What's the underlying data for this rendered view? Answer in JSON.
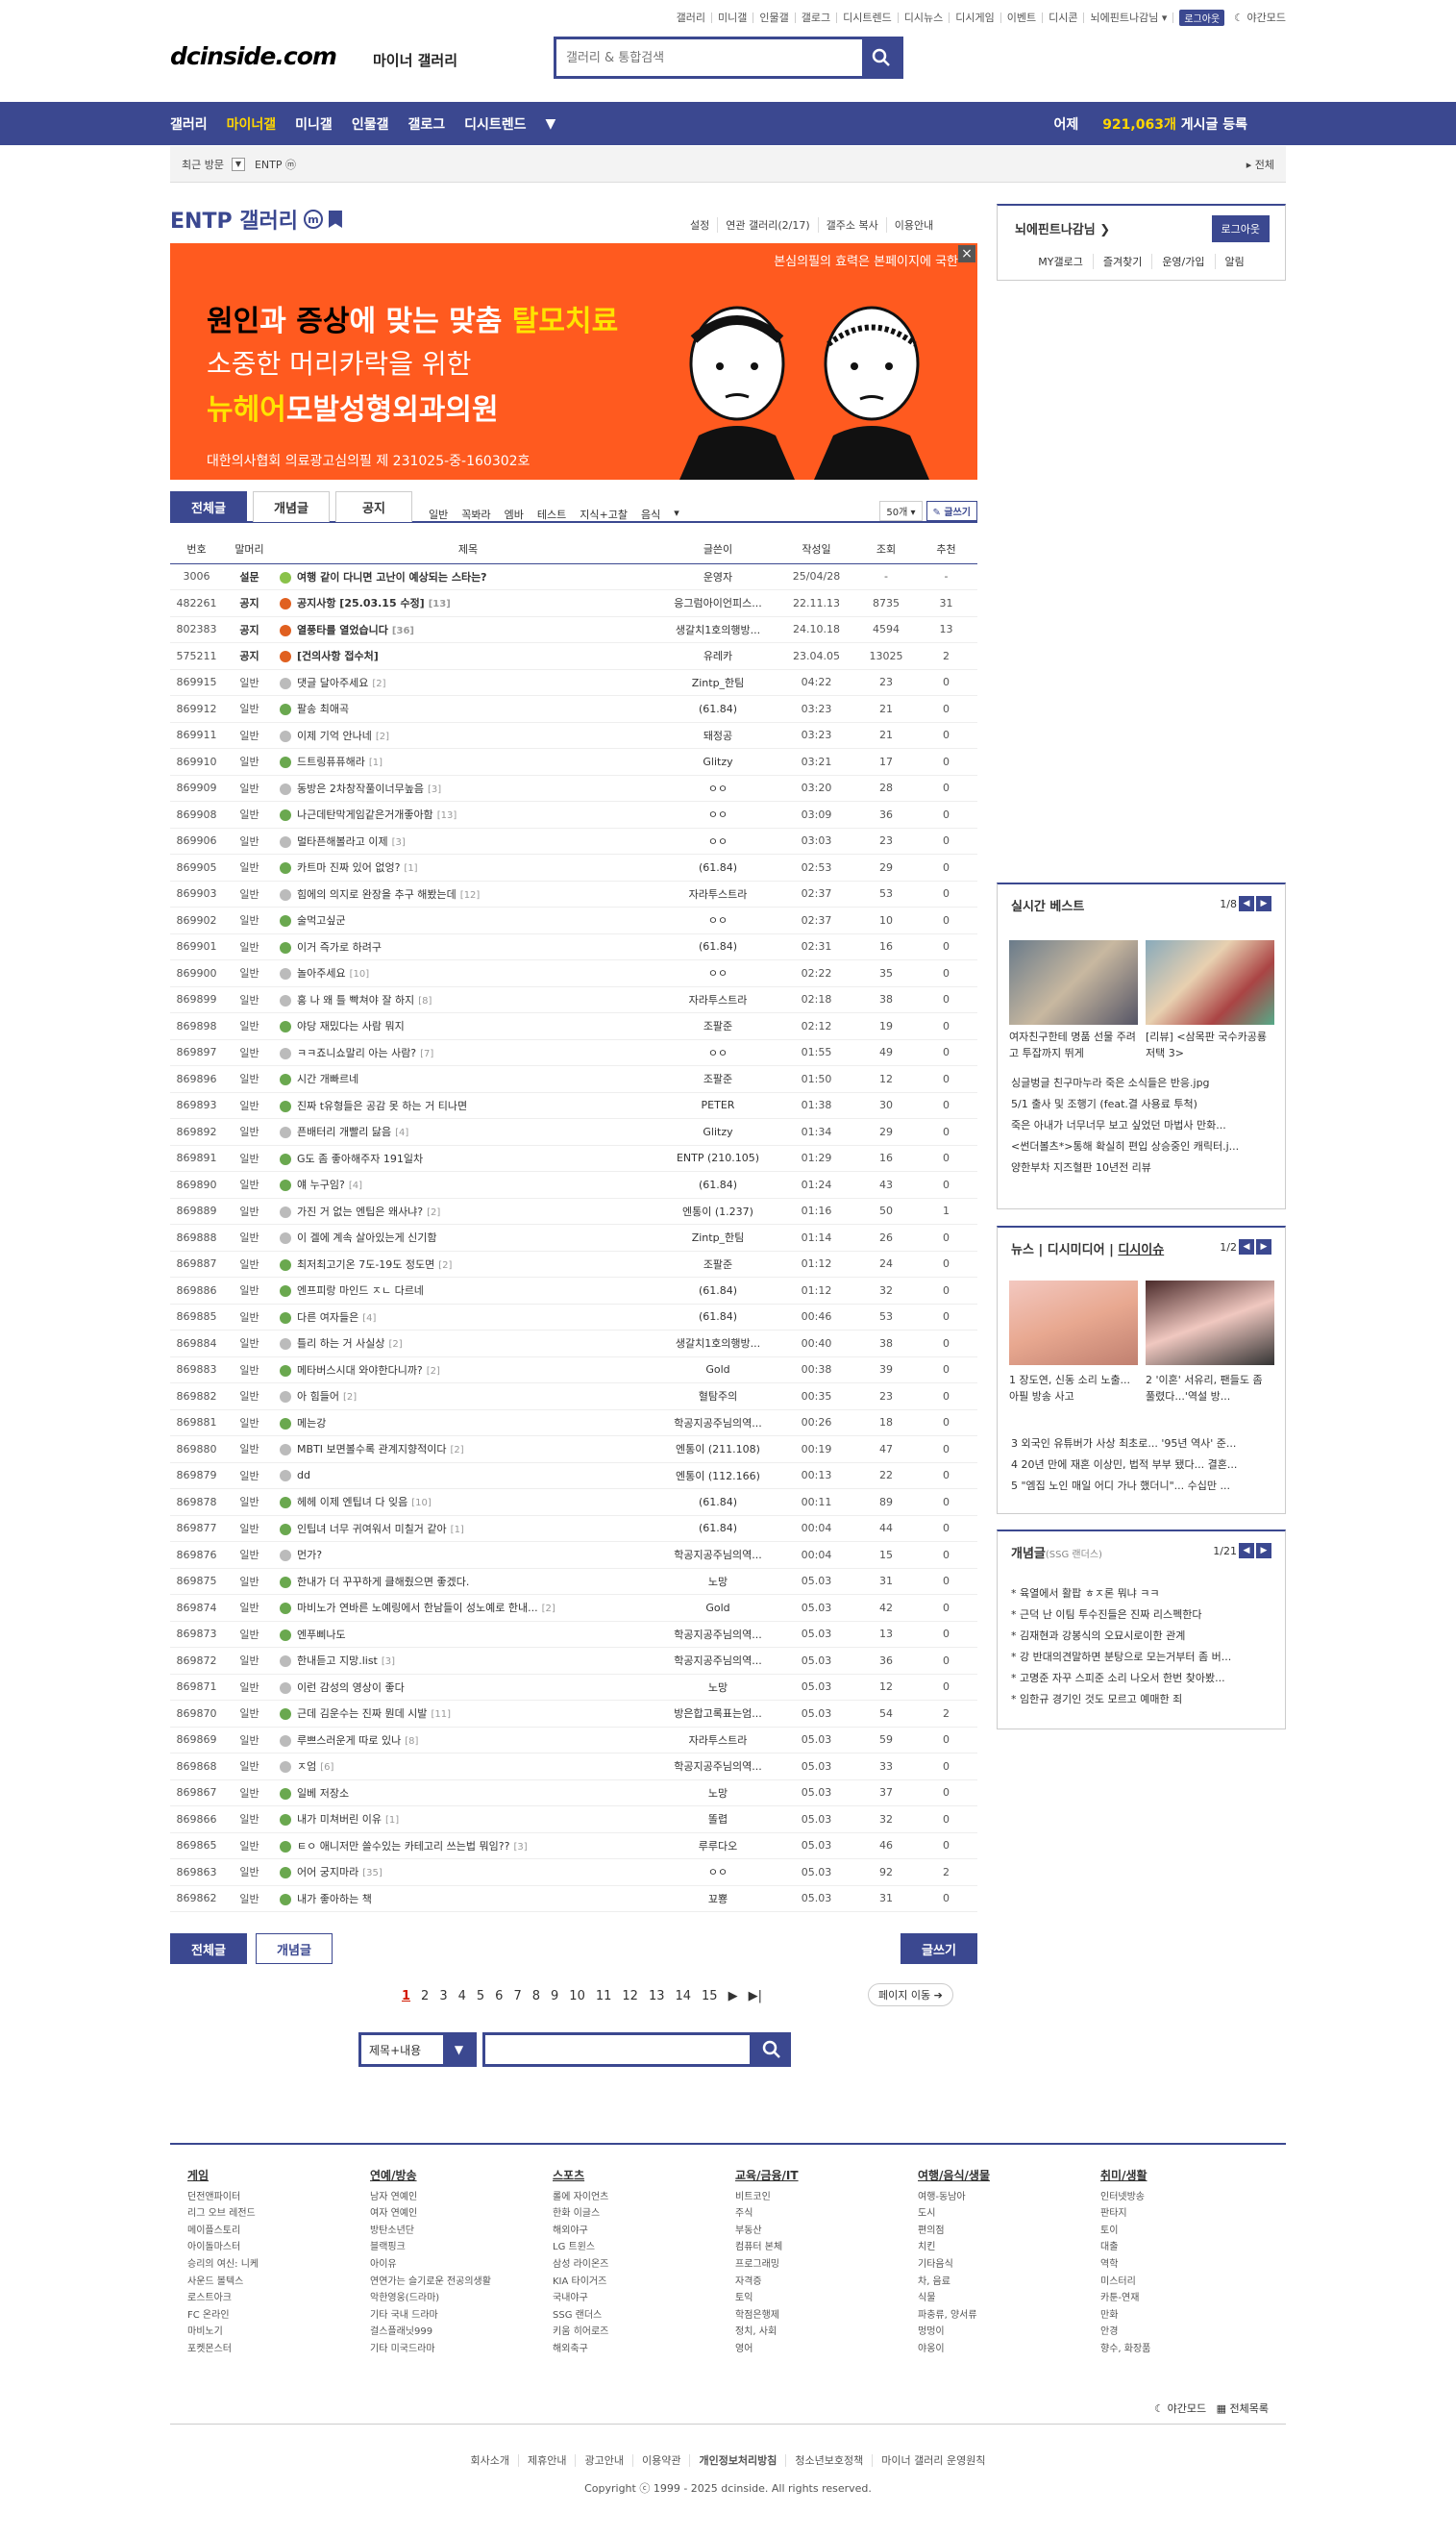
{
  "util": [
    "갤러리",
    "미니갤",
    "인물갤",
    "갤로그",
    "디시트렌드",
    "디시뉴스",
    "디시게임",
    "이벤트",
    "디시콘"
  ],
  "util_user": "뇌에핀트나감님",
  "util_logout": "로그아웃",
  "util_night": "야간모드",
  "logo": "dcinside.com",
  "logo_sub": "마이너 갤러리",
  "search_placeholder": "갤러리 & 통합검색",
  "nav": [
    "갤러리",
    "마이너갤",
    "미니갤",
    "인물갤",
    "갤로그",
    "디시트렌드"
  ],
  "visitors": {
    "pre": "어제",
    "count": "921,063개",
    "post": "게시글 등록"
  },
  "recent": {
    "label": "최근 방문",
    "item": "ENTP ⓜ",
    "all": "전체"
  },
  "gallery": {
    "title": "ENTP 갤러리",
    "badge": "m"
  },
  "gtools": [
    "설정",
    "연관 갤러리(2/17)",
    "갤주소 복사",
    "이용안내"
  ],
  "banner": {
    "top": "본심의필의 효력은 본페이지에 국한",
    "l1a": "원인",
    "l1b": "과 ",
    "l1c": "증상",
    "l1d": "에 맞는 맞춤 ",
    "l1e": "탈모치료",
    "l2": "소중한 머리카락을 위한",
    "l3a": "뉴헤어",
    "l3b": "모발성형외과의원",
    "l4": "대한의사협회 의료광고심의필 제 231025-중-160302호"
  },
  "login": {
    "nick": "뇌에핀트나감님",
    "logout": "로그아웃",
    "links": [
      "MY갤로그",
      "즐겨찾기",
      "운영/가입",
      "알림"
    ]
  },
  "tabs": [
    "전체글",
    "개념글",
    "공지"
  ],
  "filters": [
    "일반",
    "꼭봐라",
    "엠바",
    "테스트",
    "지식+고찰",
    "음식"
  ],
  "listopt": {
    "num": "50개",
    "write": "글쓰기"
  },
  "headers": [
    "번호",
    "말머리",
    "제목",
    "글쓴이",
    "작성일",
    "조회",
    "추천"
  ],
  "rows": [
    {
      "no": "3006",
      "h": "설문",
      "t": "여행 같이 다니면 고난이 예상되는 스타는?",
      "c": "",
      "w": "운영자",
      "d": "25/04/28",
      "v": "-",
      "r": "-",
      "k": "s",
      "b": 1
    },
    {
      "no": "482261",
      "h": "공지",
      "t": "공지사항 [25.03.15 수정]",
      "c": "[13]",
      "w": "응그럼아이언피스...",
      "d": "22.11.13",
      "v": "8735",
      "r": "31",
      "k": "n",
      "b": 1
    },
    {
      "no": "802383",
      "h": "공지",
      "t": "열풍타를 열었습니다",
      "c": "[36]",
      "w": "생갈치1호의행방...",
      "d": "24.10.18",
      "v": "4594",
      "r": "13",
      "k": "n",
      "b": 1
    },
    {
      "no": "575211",
      "h": "공지",
      "t": "[건의사항 접수처]",
      "c": "",
      "w": "유레카",
      "d": "23.04.05",
      "v": "13025",
      "r": "2",
      "k": "n",
      "b": 1
    },
    {
      "no": "869915",
      "h": "일반",
      "t": "댓글 달아주세요",
      "c": "[2]",
      "w": "Zintp_한팀",
      "d": "04:22",
      "v": "23",
      "r": "0",
      "k": "c"
    },
    {
      "no": "869912",
      "h": "일반",
      "t": "팔송 최애곡",
      "c": "",
      "w": "(61.84)",
      "d": "03:23",
      "v": "21",
      "r": "0",
      "k": "g"
    },
    {
      "no": "869911",
      "h": "일반",
      "t": "이제 기억 안나네",
      "c": "[2]",
      "w": "돼정공",
      "d": "03:23",
      "v": "21",
      "r": "0",
      "k": "c"
    },
    {
      "no": "869910",
      "h": "일반",
      "t": "드트링퓨퓨해라",
      "c": "[1]",
      "w": "Glitzy",
      "d": "03:21",
      "v": "17",
      "r": "0",
      "k": "g"
    },
    {
      "no": "869909",
      "h": "일반",
      "t": "동방은 2차창작풀이너무높음",
      "c": "[3]",
      "w": "ㅇㅇ",
      "d": "03:20",
      "v": "28",
      "r": "0",
      "k": "c"
    },
    {
      "no": "869908",
      "h": "일반",
      "t": "나근데탄막게임같은거개좋아함",
      "c": "[13]",
      "w": "ㅇㅇ",
      "d": "03:09",
      "v": "36",
      "r": "0",
      "k": "g"
    },
    {
      "no": "869906",
      "h": "일반",
      "t": "멀타픈해볼라고 이제",
      "c": "[3]",
      "w": "ㅇㅇ",
      "d": "03:03",
      "v": "23",
      "r": "0",
      "k": "c"
    },
    {
      "no": "869905",
      "h": "일반",
      "t": "카트마 진짜 있어 없엉?",
      "c": "[1]",
      "w": "(61.84)",
      "d": "02:53",
      "v": "29",
      "r": "0",
      "k": "g"
    },
    {
      "no": "869903",
      "h": "일반",
      "t": "힘에의 의지로 완장을 추구 해봤는데",
      "c": "[12]",
      "w": "자라투스트라",
      "d": "02:37",
      "v": "53",
      "r": "0",
      "k": "c"
    },
    {
      "no": "869902",
      "h": "일반",
      "t": "술먹고싶군",
      "c": "",
      "w": "ㅇㅇ",
      "d": "02:37",
      "v": "10",
      "r": "0",
      "k": "g"
    },
    {
      "no": "869901",
      "h": "일반",
      "t": "이거 즉가로 하려구",
      "c": "",
      "w": "(61.84)",
      "d": "02:31",
      "v": "16",
      "r": "0",
      "k": "g"
    },
    {
      "no": "869900",
      "h": "일반",
      "t": "놀아주세요",
      "c": "[10]",
      "w": "ㅇㅇ",
      "d": "02:22",
      "v": "35",
      "r": "0",
      "k": "c"
    },
    {
      "no": "869899",
      "h": "일반",
      "t": "홍 나 왜 틀 빡쳐야 잘 하지",
      "c": "[8]",
      "w": "자라투스트라",
      "d": "02:18",
      "v": "38",
      "r": "0",
      "k": "c"
    },
    {
      "no": "869898",
      "h": "일반",
      "t": "야당 재밌다는 사람 뭐지",
      "c": "",
      "w": "조팔준",
      "d": "02:12",
      "v": "19",
      "r": "0",
      "k": "g"
    },
    {
      "no": "869897",
      "h": "일반",
      "t": "ㅋㅋ죠니쇼말리 아는 사람?",
      "c": "[7]",
      "w": "ㅇㅇ",
      "d": "01:55",
      "v": "49",
      "r": "0",
      "k": "c"
    },
    {
      "no": "869896",
      "h": "일반",
      "t": "시간 개빠르네",
      "c": "",
      "w": "조팔준",
      "d": "01:50",
      "v": "12",
      "r": "0",
      "k": "g"
    },
    {
      "no": "869893",
      "h": "일반",
      "t": "진짜 t유형들은 공감 못 하는 거 티나면",
      "c": "",
      "w": "PETER",
      "d": "01:38",
      "v": "30",
      "r": "0",
      "k": "g"
    },
    {
      "no": "869892",
      "h": "일반",
      "t": "픈배터리 개빨리 닳음",
      "c": "[4]",
      "w": "Glitzy",
      "d": "01:34",
      "v": "29",
      "r": "0",
      "k": "c"
    },
    {
      "no": "869891",
      "h": "일반",
      "t": "G도 좀 좋아해주자 191일차",
      "c": "",
      "w": "ENTP (210.105)",
      "d": "01:29",
      "v": "16",
      "r": "0",
      "k": "g"
    },
    {
      "no": "869890",
      "h": "일반",
      "t": "얘 누구임?",
      "c": "[4]",
      "w": "(61.84)",
      "d": "01:24",
      "v": "43",
      "r": "0",
      "k": "g"
    },
    {
      "no": "869889",
      "h": "일반",
      "t": "가진 거 없는 엔팁은 왜사냐?",
      "c": "[2]",
      "w": "엔통이 (1.237)",
      "d": "01:16",
      "v": "50",
      "r": "1",
      "k": "c"
    },
    {
      "no": "869888",
      "h": "일반",
      "t": "이 겔에 계속 살아있는게 신기함",
      "c": "",
      "w": "Zintp_한팀",
      "d": "01:14",
      "v": "26",
      "r": "0",
      "k": "c"
    },
    {
      "no": "869887",
      "h": "일반",
      "t": "최저최고기온 7도-19도 정도면",
      "c": "[2]",
      "w": "조팔준",
      "d": "01:12",
      "v": "24",
      "r": "0",
      "k": "g"
    },
    {
      "no": "869886",
      "h": "일반",
      "t": "엔프피랑 마인드 ㅈㄴ 다르네",
      "c": "",
      "w": "(61.84)",
      "d": "01:12",
      "v": "32",
      "r": "0",
      "k": "g"
    },
    {
      "no": "869885",
      "h": "일반",
      "t": "다른 여자들은",
      "c": "[4]",
      "w": "(61.84)",
      "d": "00:46",
      "v": "53",
      "r": "0",
      "k": "g"
    },
    {
      "no": "869884",
      "h": "일반",
      "t": "틀리 하는 거 사실상",
      "c": "[2]",
      "w": "생갈치1호의행방...",
      "d": "00:40",
      "v": "38",
      "r": "0",
      "k": "c"
    },
    {
      "no": "869883",
      "h": "일반",
      "t": "메타버스시대 와야한다니까?",
      "c": "[2]",
      "w": "Gold",
      "d": "00:38",
      "v": "39",
      "r": "0",
      "k": "g"
    },
    {
      "no": "869882",
      "h": "일반",
      "t": "아 힘들어",
      "c": "[2]",
      "w": "혈탐주의",
      "d": "00:35",
      "v": "23",
      "r": "0",
      "k": "c"
    },
    {
      "no": "869881",
      "h": "일반",
      "t": "메는강",
      "c": "",
      "w": "학공지공주님의역...",
      "d": "00:26",
      "v": "18",
      "r": "0",
      "k": "g"
    },
    {
      "no": "869880",
      "h": "일반",
      "t": "MBTI 보면볼수록 관계지향적이다",
      "c": "[2]",
      "w": "엔통이 (211.108)",
      "d": "00:19",
      "v": "47",
      "r": "0",
      "k": "c"
    },
    {
      "no": "869879",
      "h": "일반",
      "t": "dd",
      "c": "",
      "w": "엔통이 (112.166)",
      "d": "00:13",
      "v": "22",
      "r": "0",
      "k": "c"
    },
    {
      "no": "869878",
      "h": "일반",
      "t": "헤헤 이제 엔팁녀 다 잊음",
      "c": "[10]",
      "w": "(61.84)",
      "d": "00:11",
      "v": "89",
      "r": "0",
      "k": "g"
    },
    {
      "no": "869877",
      "h": "일반",
      "t": "인팁녀 너무 귀여워서 미칠거 같아",
      "c": "[1]",
      "w": "(61.84)",
      "d": "00:04",
      "v": "44",
      "r": "0",
      "k": "g"
    },
    {
      "no": "869876",
      "h": "일반",
      "t": "먼가?",
      "c": "",
      "w": "학공지공주님의역...",
      "d": "00:04",
      "v": "15",
      "r": "0",
      "k": "c"
    },
    {
      "no": "869875",
      "h": "일반",
      "t": "한내가 더 꾸꾸하게 클해줬으면 좋겠다.",
      "c": "",
      "w": "노망",
      "d": "05.03",
      "v": "31",
      "r": "0",
      "k": "g"
    },
    {
      "no": "869874",
      "h": "일반",
      "t": "마비노가 연바른 노예링에서 한남들이 성노예로 한내...",
      "c": "[2]",
      "w": "Gold",
      "d": "05.03",
      "v": "42",
      "r": "0",
      "k": "g"
    },
    {
      "no": "869873",
      "h": "일반",
      "t": "엔푸삐나도",
      "c": "",
      "w": "학공지공주님의역...",
      "d": "05.03",
      "v": "13",
      "r": "0",
      "k": "g"
    },
    {
      "no": "869872",
      "h": "일반",
      "t": "한내듣고 지망.list",
      "c": "[3]",
      "w": "학공지공주님의역...",
      "d": "05.03",
      "v": "36",
      "r": "0",
      "k": "c"
    },
    {
      "no": "869871",
      "h": "일반",
      "t": "이런 감성의 영상이 좋다",
      "c": "",
      "w": "노망",
      "d": "05.03",
      "v": "12",
      "r": "0",
      "k": "c"
    },
    {
      "no": "869870",
      "h": "일반",
      "t": "근데 김운수는 진짜 뭔데 시발",
      "c": "[11]",
      "w": "방은합고록표는엄...",
      "d": "05.03",
      "v": "54",
      "r": "2",
      "k": "g"
    },
    {
      "no": "869869",
      "h": "일반",
      "t": "루쁘스러운게 따로 있나",
      "c": "[8]",
      "w": "자라투스트라",
      "d": "05.03",
      "v": "59",
      "r": "0",
      "k": "c"
    },
    {
      "no": "869868",
      "h": "일반",
      "t": "ㅈ엄",
      "c": "[6]",
      "w": "학공지공주님의역...",
      "d": "05.03",
      "v": "33",
      "r": "0",
      "k": "c"
    },
    {
      "no": "869867",
      "h": "일반",
      "t": "일베 저장소",
      "c": "",
      "w": "노망",
      "d": "05.03",
      "v": "37",
      "r": "0",
      "k": "g"
    },
    {
      "no": "869866",
      "h": "일반",
      "t": "내가 미쳐버린 이유",
      "c": "[1]",
      "w": "똘렵",
      "d": "05.03",
      "v": "32",
      "r": "0",
      "k": "g"
    },
    {
      "no": "869865",
      "h": "일반",
      "t": "ㅌㅇ 애니저만 쓸수있는 카테고리 쓰는법 뭐임??",
      "c": "[3]",
      "w": "루루다오",
      "d": "05.03",
      "v": "46",
      "r": "0",
      "k": "g"
    },
    {
      "no": "869863",
      "h": "일반",
      "t": "어어 궁지마라",
      "c": "[35]",
      "w": "ㅇㅇ",
      "d": "05.03",
      "v": "92",
      "r": "2",
      "k": "g"
    },
    {
      "no": "869862",
      "h": "일반",
      "t": "내가 좋아하는 책",
      "c": "",
      "w": "꾜뿅",
      "d": "05.03",
      "v": "31",
      "r": "0",
      "k": "g"
    }
  ],
  "bottom": {
    "all": "전체글",
    "best": "개념글",
    "write": "글쓰기",
    "page_move": "페이지 이동"
  },
  "pages": [
    "1",
    "2",
    "3",
    "4",
    "5",
    "6",
    "7",
    "8",
    "9",
    "10",
    "11",
    "12",
    "13",
    "14",
    "15"
  ],
  "bsearch": {
    "sel": "제목+내용"
  },
  "best": {
    "title": "실시간 베스트",
    "page": "1/8",
    "caps": [
      "여자친구한테 명품 선물 주려고 투잡까지 뛰게",
      "[리뷰] <삼목판 국수카공룡 저택 3>"
    ],
    "items": [
      "싱글벙글 친구마누라 죽은 소식들은 반응.jpg",
      "5/1 출사 및 조행기 (feat.결 사용료 투척)",
      "죽은 아내가 너무너무 보고 싶었던 마법사 만화...",
      "<썬더볼츠*>통해 확실히 편입 상승중인 캐릭터.j...",
      "양한부차 지즈혈판 10년전 리뷰"
    ]
  },
  "news": {
    "tabs": [
      "뉴스",
      "디시미디어",
      "디시이슈"
    ],
    "page": "1/2",
    "caps": [
      "1 장도연, 신동 소리 노출... 아필 방송 사고",
      "2 '이혼' 서유리, 팬들도 좀 풀렸다...'역설 방..."
    ],
    "items": [
      "3 외국인 유튜버가 사상 최초로... '95년 역사' 준...",
      "4 20년 만에 재혼 이상민, 법적 부부 됐다... 결혼...",
      "5 \"엠집 노인 매일 어디 가나 했더니\"... 수십만 ..."
    ]
  },
  "concept": {
    "title": "개념글",
    "sub": "(SSG 랜더스)",
    "page": "1/21",
    "items": [
      "* 육열에서 활팝 ㅎㅈ론 뭐냐 ㅋㅋ",
      "* 근덕 난 이팀 투수진들은 진짜 리스펙한다",
      "* 김재현과 강봉식의 오묘시로이한 관계",
      "* 강 반대의견말하면 분탕으로 모는거부터 좀 버...",
      "* 고명준 자꾸 스피준 소리 나오서 한번 찾아봤...",
      "* 임한규 경기인 것도 모르고 예매한 죄"
    ]
  },
  "footer_cols": [
    {
      "h": "게임",
      "items": [
        "던전앤파이터",
        "리그 오브 레전드",
        "메이플스토리",
        "아이돌마스터",
        "승리의 여신: 니케",
        "사운드 볼텍스",
        "로스트아크",
        "FC 온라인",
        "마비노기",
        "포켓몬스터"
      ]
    },
    {
      "h": "연예/방송",
      "items": [
        "남자 연예인",
        "여자 연예인",
        "방탄소년단",
        "블랙핑크",
        "아이유",
        "연연가는 슬기로운 전공의생활",
        "악한영웅(드라마)",
        "기타 국내 드라마",
        "걸스플래닛999",
        "기타 미국드라마"
      ]
    },
    {
      "h": "스포츠",
      "items": [
        "롤에 자이언츠",
        "한화 이글스",
        "해외야구",
        "LG 트윈스",
        "삼성 라이온즈",
        "KIA 타이거즈",
        "국내야구",
        "SSG 랜더스",
        "키움 히어로즈",
        "해외축구"
      ]
    },
    {
      "h": "교육/금융/IT",
      "items": [
        "비트코인",
        "주식",
        "부동산",
        "컴퓨터 본체",
        "프로그래밍",
        "자격증",
        "토익",
        "학점은행제",
        "정치, 사회",
        "영어"
      ]
    },
    {
      "h": "여행/음식/생물",
      "items": [
        "여행-동남아",
        "도시",
        "편의점",
        "치킨",
        "기타음식",
        "차, 음료",
        "식물",
        "파충류, 양서류",
        "멍멍이",
        "야옹이"
      ]
    },
    {
      "h": "취미/생활",
      "items": [
        "인터넷방송",
        "판타지",
        "토이",
        "대출",
        "역학",
        "미스터리",
        "카툰-연재",
        "만화",
        "안경",
        "향수, 화장품"
      ]
    }
  ],
  "footer_night": "야간모드",
  "footer_all": "전체목록",
  "flinks": [
    "회사소개",
    "제휴안내",
    "광고안내",
    "이용약관",
    "개인정보처리방침",
    "청소년보호정책",
    "마이너 갤러리 운영원칙"
  ],
  "copyright": "Copyright ⓒ 1999 - 2025 dcinside. All rights reserved."
}
